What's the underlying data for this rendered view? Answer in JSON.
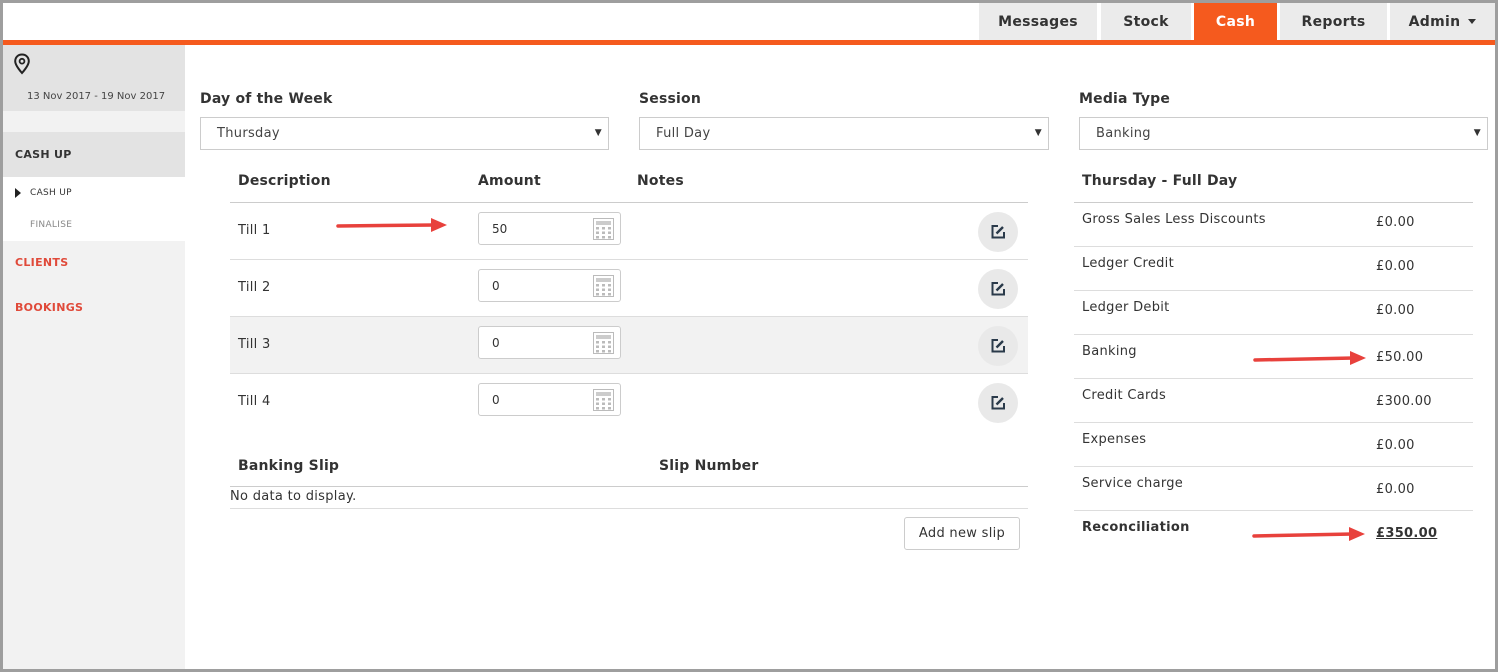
{
  "nav": {
    "tabs": [
      {
        "label": "Messages"
      },
      {
        "label": "Stock"
      },
      {
        "label": "Cash"
      },
      {
        "label": "Reports"
      },
      {
        "label": "Admin"
      }
    ]
  },
  "sidebar": {
    "date_range": "13 Nov 2017 - 19 Nov 2017",
    "section": "CASH UP",
    "sub_items": [
      {
        "label": "CASH UP"
      },
      {
        "label": "FINALISE"
      }
    ],
    "links": [
      {
        "label": "CLIENTS"
      },
      {
        "label": "BOOKINGS"
      }
    ]
  },
  "filters": {
    "day": {
      "label": "Day of the Week",
      "value": "Thursday"
    },
    "session": {
      "label": "Session",
      "value": "Full Day"
    },
    "media": {
      "label": "Media Type",
      "value": "Banking"
    }
  },
  "tills": {
    "headers": {
      "description": "Description",
      "amount": "Amount",
      "notes": "Notes"
    },
    "rows": [
      {
        "description": "Till 1",
        "amount": "50"
      },
      {
        "description": "Till 2",
        "amount": "0"
      },
      {
        "description": "Till 3",
        "amount": "0"
      },
      {
        "description": "Till 4",
        "amount": "0"
      }
    ]
  },
  "slips": {
    "headers": {
      "banking_slip": "Banking Slip",
      "slip_number": "Slip Number"
    },
    "empty_text": "No data to display.",
    "add_label": "Add new slip"
  },
  "summary": {
    "title": "Thursday - Full Day",
    "rows": [
      {
        "label": "Gross Sales Less Discounts",
        "amount": "£0.00"
      },
      {
        "label": "Ledger Credit",
        "amount": "£0.00"
      },
      {
        "label": "Ledger Debit",
        "amount": "£0.00"
      },
      {
        "label": "Banking",
        "amount": "£50.00"
      },
      {
        "label": "Credit Cards",
        "amount": "£300.00"
      },
      {
        "label": "Expenses",
        "amount": "£0.00"
      },
      {
        "label": "Service charge",
        "amount": "£0.00"
      }
    ],
    "total": {
      "label": "Reconciliation",
      "amount": "£350.00"
    }
  },
  "colors": {
    "accent": "#f55a1e",
    "link": "#e04a3a",
    "annotation_arrow": "#e8413c"
  },
  "icons": {
    "location": "map-pin-icon",
    "amount_field": "calculator-icon",
    "edit": "edit-note-icon",
    "dropdown": "caret-down-icon"
  }
}
